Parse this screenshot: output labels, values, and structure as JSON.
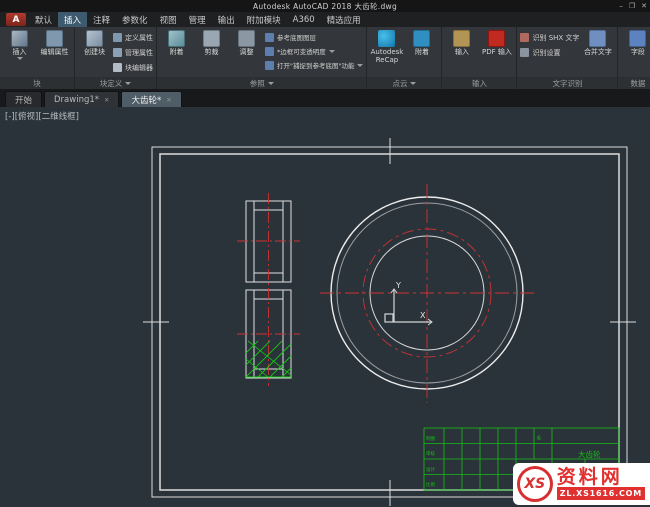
{
  "window": {
    "title": "Autodesk AutoCAD 2018  大齿轮.dwg",
    "controls": {
      "minimize": "–",
      "maximize": "❐",
      "close": "✕"
    }
  },
  "app_icon": "A",
  "icons": {
    "close_tab": "✕"
  },
  "menu_tabs": [
    "默认",
    "插入",
    "注释",
    "参数化",
    "视图",
    "管理",
    "输出",
    "附加模块",
    "A360",
    "精选应用"
  ],
  "ribbon": {
    "block": {
      "label": "块",
      "insert": "插入",
      "edit_attr": "编辑属性"
    },
    "blockdef": {
      "label": "块定义",
      "create": "创建块",
      "define_attr": "定义属性",
      "manage_attr": "管理属性",
      "block_editor": "块编辑器"
    },
    "reference": {
      "label": "参照",
      "attach": "附着",
      "clip": "剪裁",
      "adjust": "调整",
      "underlay_layers": "参考底图图层",
      "frame_transparency": "*边框可变透明度",
      "snap_underlay": "打开\"捕捉到参考底图\"功能"
    },
    "pointcloud": {
      "label": "点云",
      "recap": "Autodesk ReCap",
      "attach": "附着"
    },
    "import_panel": {
      "label": "输入",
      "import_btn": "输入",
      "pdf_import": "PDF 输入"
    },
    "text_recog": {
      "label": "文字识别",
      "recognize": "识别 SHX 文字",
      "settings": "识别设置",
      "combine": "合并文字"
    },
    "data_panel": {
      "label": "数据",
      "field": "字段"
    }
  },
  "file_tabs": [
    "开始",
    "Drawing1*",
    "大齿轮*"
  ],
  "viewport_label": "[-][俯视][二维线框]",
  "drawing": {
    "ucs_y": "Y",
    "ucs_x": "X",
    "title_block": {
      "name": "大齿轮",
      "qty": "6",
      "c1": "制图",
      "c2": "审核",
      "c3": "设计",
      "c4": "比例"
    }
  },
  "watermark": {
    "logo": "XS",
    "name": "资料网",
    "site": "ZL.XS1616.COM"
  },
  "colors": {
    "canvas_bg": "#2b333a",
    "line_white": "#e8e8e8",
    "centerline_red": "#cc3333",
    "hatch_green": "#16c216",
    "watermark_red": "#e03030"
  }
}
